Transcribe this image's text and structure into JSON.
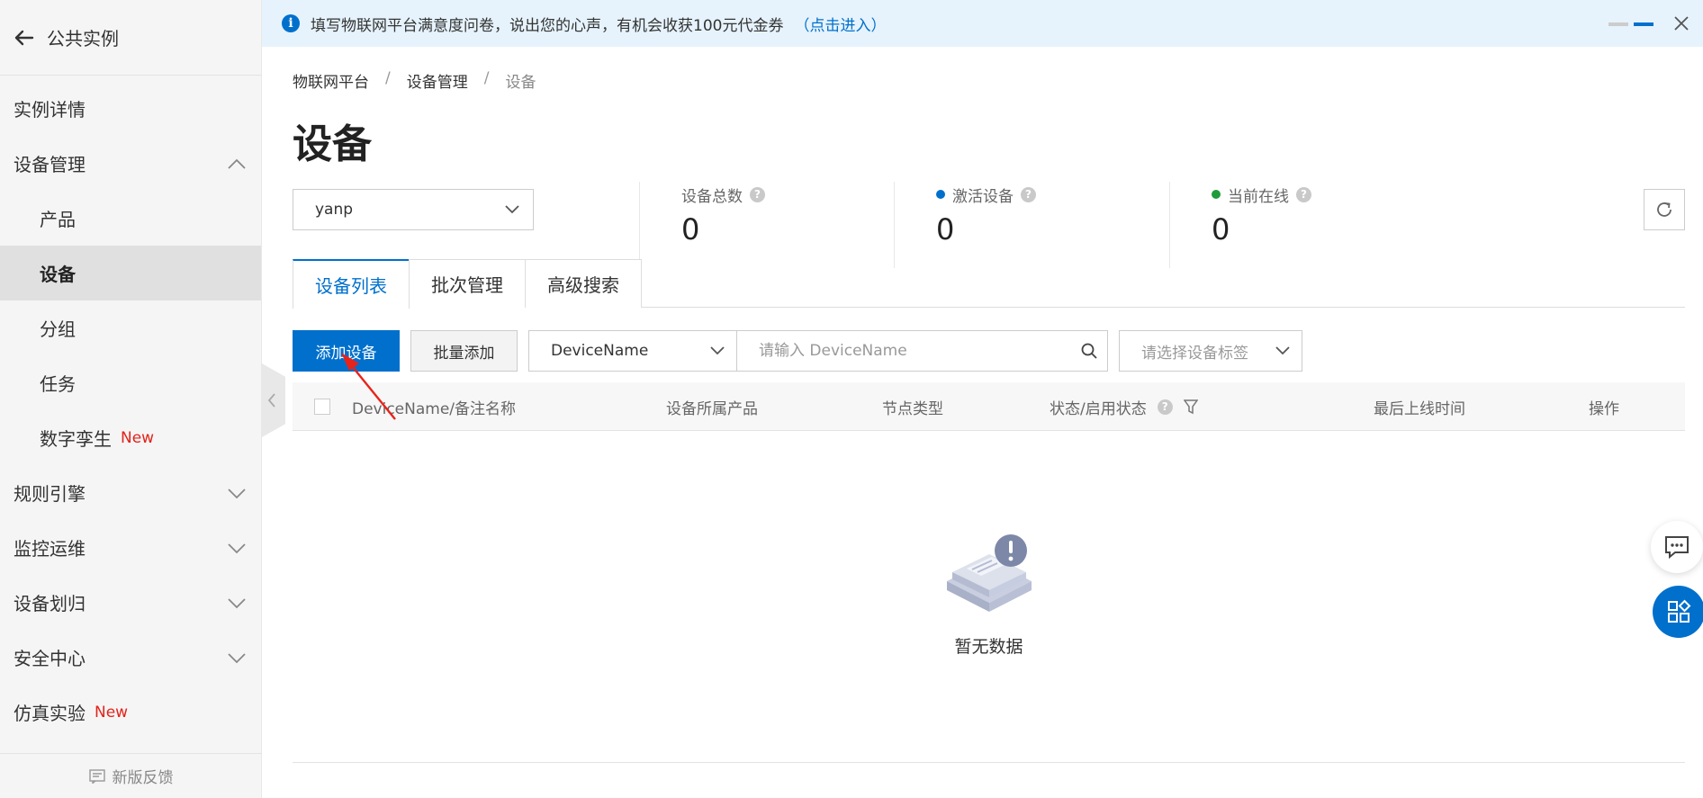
{
  "sidebar": {
    "title": "公共实例",
    "items": [
      {
        "label": "实例详情"
      },
      {
        "label": "设备管理"
      },
      {
        "label": "产品"
      },
      {
        "label": "设备"
      },
      {
        "label": "分组"
      },
      {
        "label": "任务"
      },
      {
        "label": "数字孪生",
        "badge": "New"
      },
      {
        "label": "规则引擎"
      },
      {
        "label": "监控运维"
      },
      {
        "label": "设备划归"
      },
      {
        "label": "安全中心"
      },
      {
        "label": "仿真实验",
        "badge": "New"
      }
    ],
    "footer": "新版反馈"
  },
  "banner": {
    "text": "填写物联网平台满意度问卷，说出您的心声，有机会收获100元代金券",
    "link": "（点击进入）"
  },
  "breadcrumb": [
    "物联网平台",
    "设备管理",
    "设备"
  ],
  "page_title": "设备",
  "product_select": {
    "value": "yanp"
  },
  "stats": [
    {
      "label": "设备总数",
      "value": "0",
      "color": ""
    },
    {
      "label": "激活设备",
      "value": "0",
      "color": "#0070cc"
    },
    {
      "label": "当前在线",
      "value": "0",
      "color": "#1e9b3b"
    }
  ],
  "tabs": [
    "设备列表",
    "批次管理",
    "高级搜索"
  ],
  "toolbar": {
    "add_label": "添加设备",
    "batch_label": "批量添加",
    "field_value": "DeviceName",
    "search_placeholder": "请输入 DeviceName",
    "tag_placeholder": "请选择设备标签"
  },
  "table": {
    "columns": [
      "DeviceName/备注名称",
      "设备所属产品",
      "节点类型",
      "状态/启用状态",
      "最后上线时间",
      "操作"
    ]
  },
  "empty_text": "暂无数据",
  "colors": {
    "accent": "#0070cc",
    "new_badge": "#e2231a",
    "online": "#1e9b3b"
  }
}
